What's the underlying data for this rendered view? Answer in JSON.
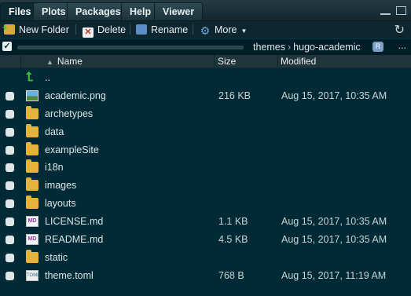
{
  "tabs": [
    {
      "label": "Files",
      "active": true
    },
    {
      "label": "Plots"
    },
    {
      "label": "Packages"
    },
    {
      "label": "Help"
    },
    {
      "label": "Viewer"
    }
  ],
  "toolbar": {
    "new_folder": "New Folder",
    "delete": "Delete",
    "rename": "Rename",
    "more": "More"
  },
  "path": {
    "crumbs": [
      "themes",
      "hugo-academic"
    ],
    "more": "..."
  },
  "columns": {
    "name": "Name",
    "size": "Size",
    "modified": "Modified"
  },
  "parent_dir": "..",
  "files": [
    {
      "name": "academic.png",
      "size": "216 KB",
      "modified": "Aug 15, 2017, 10:35 AM",
      "icon": "image-file-icon"
    },
    {
      "name": "archetypes",
      "size": "",
      "modified": "",
      "icon": "folder-icon"
    },
    {
      "name": "data",
      "size": "",
      "modified": "",
      "icon": "folder-icon"
    },
    {
      "name": "exampleSite",
      "size": "",
      "modified": "",
      "icon": "folder-icon"
    },
    {
      "name": "i18n",
      "size": "",
      "modified": "",
      "icon": "folder-icon"
    },
    {
      "name": "images",
      "size": "",
      "modified": "",
      "icon": "folder-icon"
    },
    {
      "name": "layouts",
      "size": "",
      "modified": "",
      "icon": "folder-icon"
    },
    {
      "name": "LICENSE.md",
      "size": "1.1 KB",
      "modified": "Aug 15, 2017, 10:35 AM",
      "icon": "markdown-file-icon"
    },
    {
      "name": "README.md",
      "size": "4.5 KB",
      "modified": "Aug 15, 2017, 10:35 AM",
      "icon": "markdown-file-icon"
    },
    {
      "name": "static",
      "size": "",
      "modified": "",
      "icon": "folder-icon"
    },
    {
      "name": "theme.toml",
      "size": "768 B",
      "modified": "Aug 15, 2017, 11:19 AM",
      "icon": "toml-file-icon"
    }
  ],
  "colors": {
    "background": "#002b36",
    "folder": "#e6b23a",
    "up_arrow": "#3fbf3f"
  }
}
